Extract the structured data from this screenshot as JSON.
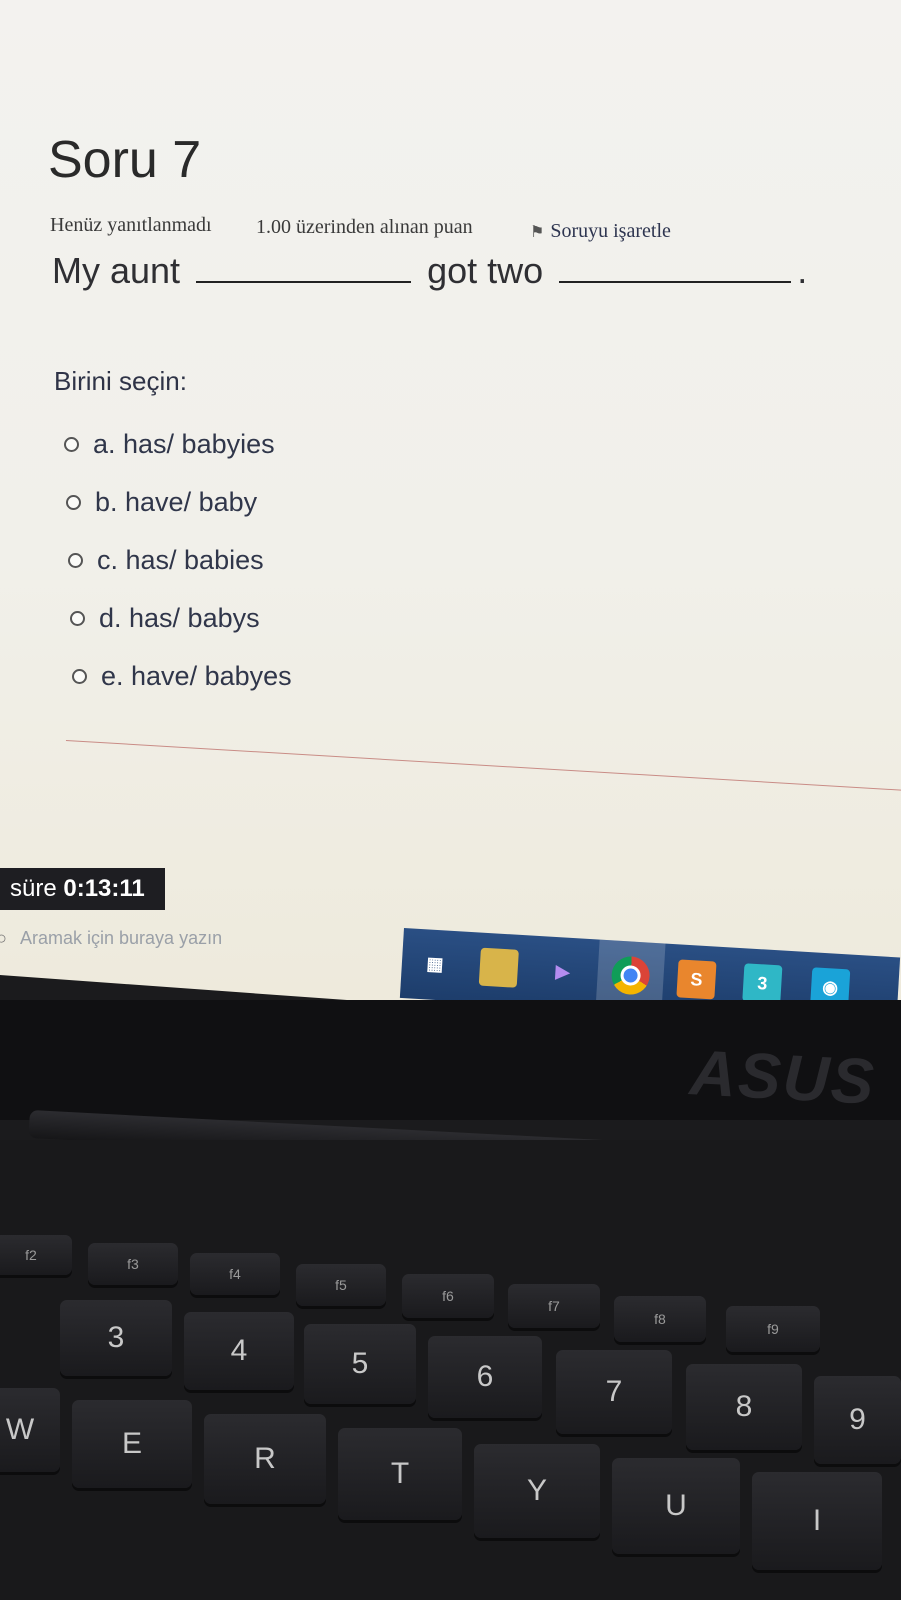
{
  "question": {
    "title": "Soru 7",
    "state": "Henüz yanıtlanmadı",
    "grade": "1.00 üzerinden alınan puan",
    "flag_label": "Soruyu işaretle",
    "text_part1": "My aunt",
    "text_part2": "got two",
    "text_end": ".",
    "prompt": "Birini seçin:",
    "options": [
      {
        "label": "a. has/ babyies"
      },
      {
        "label": "b. have/ baby"
      },
      {
        "label": "c. has/ babies"
      },
      {
        "label": "d. has/ babys"
      },
      {
        "label": "e. have/ babyes"
      }
    ]
  },
  "timer": {
    "label": "süre",
    "value": "0:13:11"
  },
  "taskbar": {
    "search_placeholder": "Aramak için buraya yazın",
    "icons": [
      "task-view-icon",
      "app-icon",
      "visual-studio-icon",
      "chrome-icon",
      "sublime-icon",
      "app-3-icon",
      "app-blue-icon"
    ],
    "app3_label": "3"
  },
  "laptop": {
    "brand": "ASUS",
    "keys": {
      "f2": "f2",
      "f3": "f3",
      "f4": "f4",
      "f5": "f5",
      "f6": "f6",
      "f7": "f7",
      "f8": "f8",
      "f9": "f9",
      "k3": "3",
      "k4": "4",
      "k5": "5",
      "k6": "6",
      "k7": "7",
      "k8": "8",
      "k9": "9",
      "E": "E",
      "R": "R",
      "T": "T",
      "Y": "Y",
      "U": "U",
      "I": "I",
      "W": "W"
    }
  }
}
